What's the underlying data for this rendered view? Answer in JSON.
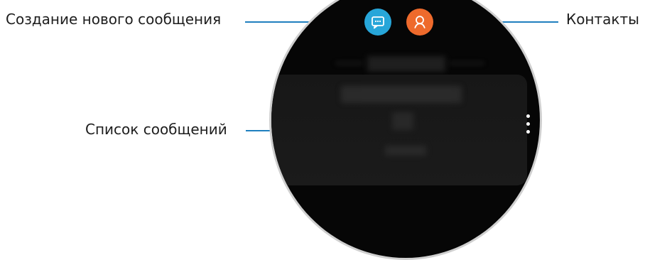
{
  "annotations": {
    "new_message": "Создание нового сообщения",
    "contacts": "Контакты",
    "message_list": "Список сообщений"
  },
  "icons": {
    "new_message": "message-icon",
    "contacts": "contact-icon",
    "more_options": "more-vertical-icon"
  },
  "colors": {
    "callout_line": "#1f7fbf",
    "new_message_button": "#27a6d9",
    "contacts_button": "#ee6a2c",
    "screen": "#060606",
    "bezel": "#cfcfcf"
  }
}
